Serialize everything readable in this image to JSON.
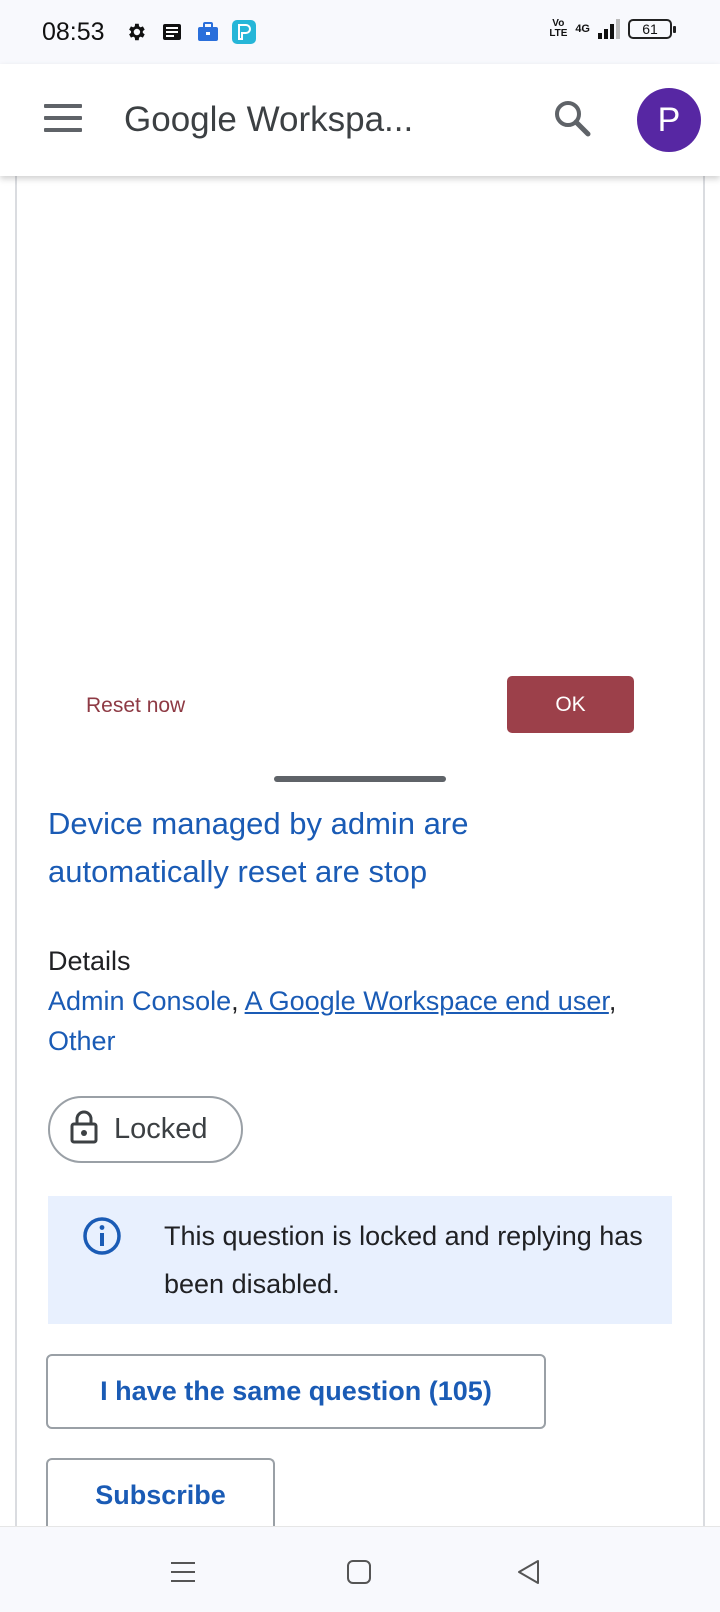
{
  "status_bar": {
    "time": "08:53",
    "icons_left": [
      "gear-icon",
      "news-icon",
      "briefcase-icon",
      "app-p-icon"
    ],
    "volte": "Vo LTE",
    "network": "4G",
    "battery": "61"
  },
  "app_bar": {
    "title": "Google Workspa...",
    "avatar_letter": "P",
    "avatar_color": "#5727a3"
  },
  "dialog": {
    "reset_label": "Reset now",
    "ok_label": "OK",
    "accent_color": "#9c404a"
  },
  "question": {
    "title": "Device managed by admin are automatically reset are stop",
    "details_heading": "Details",
    "details": {
      "item1": "Admin Console",
      "sep1": ", ",
      "item2": "A Google Workspace end user",
      "sep2": ",",
      "item3": "Other"
    },
    "locked_label": "Locked",
    "info_text": "This question is locked and replying has been disabled.",
    "same_question_label": "I have the same question (105)",
    "subscribe_label": "Subscribe",
    "link_color": "#1a5bb5"
  },
  "nav_bar": {
    "buttons": [
      "menu-nav-icon",
      "home-nav-icon",
      "back-nav-icon"
    ]
  }
}
